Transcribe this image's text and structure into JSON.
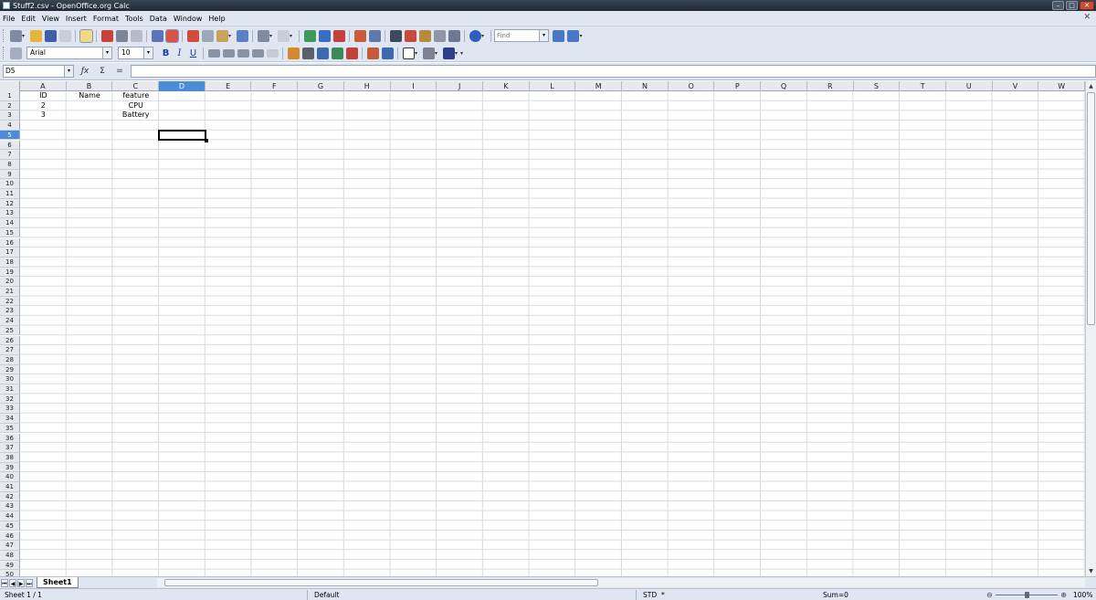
{
  "window": {
    "title": "Stuff2.csv - OpenOffice.org Calc"
  },
  "menu": [
    "File",
    "Edit",
    "View",
    "Insert",
    "Format",
    "Tools",
    "Data",
    "Window",
    "Help"
  ],
  "toolbar": {
    "find_placeholder": "Find",
    "font_name": "Arial",
    "font_size": "10",
    "bold_label": "B",
    "italic_label": "I",
    "underline_label": "U"
  },
  "formula_bar": {
    "cell_ref": "D5",
    "content": ""
  },
  "columns": [
    "A",
    "B",
    "C",
    "D",
    "E",
    "F",
    "G",
    "H",
    "I",
    "J",
    "K",
    "L",
    "M",
    "N",
    "O",
    "P",
    "Q",
    "R",
    "S",
    "T",
    "U",
    "V",
    "W"
  ],
  "active_column": "D",
  "active_row": 5,
  "row_count": 50,
  "cells": {
    "A1": "ID",
    "B1": "Name",
    "C1": "feature",
    "A2": "2",
    "C2": "CPU",
    "A3": "3",
    "C3": "Battery"
  },
  "sheet_tabs": [
    "Sheet1"
  ],
  "status": {
    "sheet": "Sheet 1 / 1",
    "page_style": "Default",
    "mode": "STD",
    "modified": "*",
    "sum": "Sum=0",
    "zoom": "100%"
  },
  "colors": {
    "accent": "#4c8bd8",
    "chrome": "#dfe5f1"
  }
}
